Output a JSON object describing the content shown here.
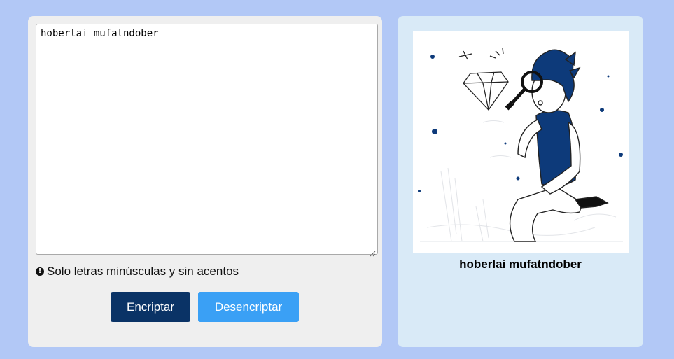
{
  "input": {
    "value": "hoberlai mufatndober"
  },
  "hint": {
    "icon": "exclamation-circle-icon",
    "text": "Solo letras minúsculas y sin acentos"
  },
  "buttons": {
    "encrypt_label": "Encriptar",
    "decrypt_label": "Desencriptar"
  },
  "output": {
    "illustration": "person-with-magnifying-glass-and-diamond",
    "result_text": "hoberlai mufatndober"
  },
  "colors": {
    "page_background": "#b2c8f6",
    "left_panel": "#efefef",
    "right_panel": "#d9eaf7",
    "encrypt_button": "#0a3366",
    "decrypt_button": "#3aa0f5",
    "illustration_accent": "#0d3a7a"
  }
}
